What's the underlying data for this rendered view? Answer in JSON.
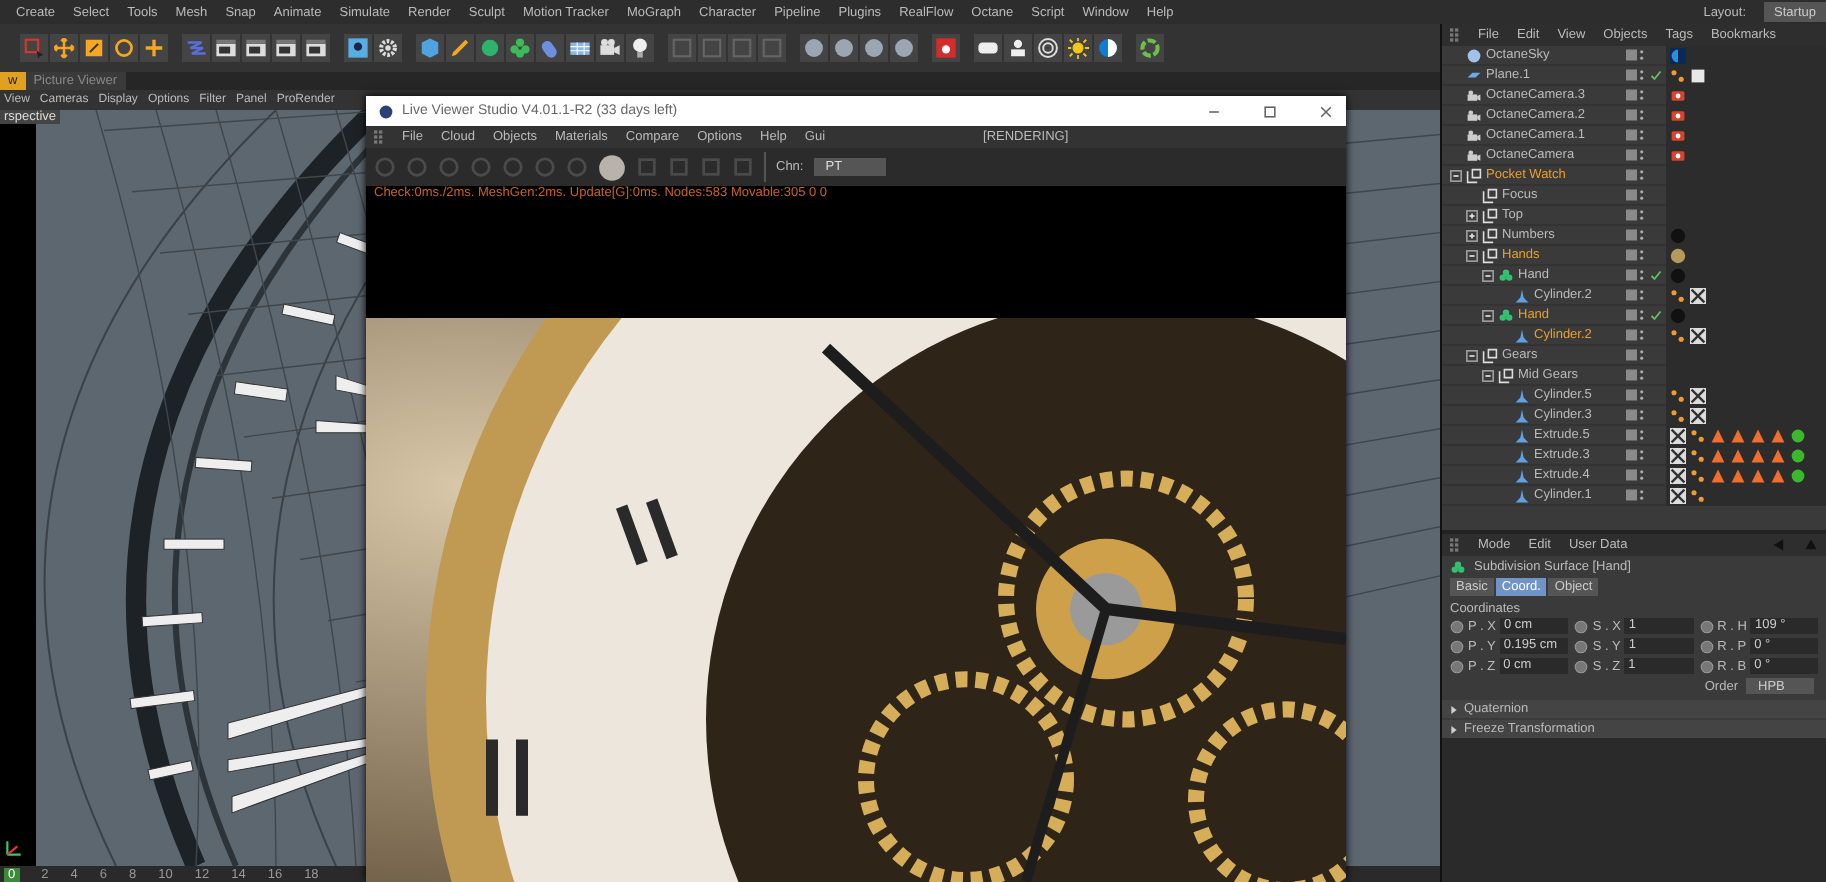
{
  "menu_bar": {
    "items": [
      "Create",
      "Select",
      "Tools",
      "Mesh",
      "Snap",
      "Animate",
      "Simulate",
      "Render",
      "Sculpt",
      "Motion Tracker",
      "MoGraph",
      "Character",
      "Pipeline",
      "Plugins",
      "RealFlow",
      "Octane",
      "Script",
      "Window",
      "Help"
    ],
    "layout_label": "Layout:",
    "layout_value": "Startup"
  },
  "view_tabs": [
    {
      "label": "w",
      "selected": true
    },
    {
      "label": "Picture Viewer",
      "selected": false
    }
  ],
  "viewport": {
    "menu": [
      "View",
      "Cameras",
      "Display",
      "Options",
      "Filter",
      "Panel",
      "ProRender"
    ],
    "camera_label": "rspective",
    "timeline_ticks": [
      "0",
      "2",
      "4",
      "6",
      "8",
      "10",
      "12",
      "14",
      "16",
      "18"
    ]
  },
  "live_viewer": {
    "title": "Live Viewer Studio V4.01.1-R2 (33 days left)",
    "menu": [
      "File",
      "Cloud",
      "Objects",
      "Materials",
      "Compare",
      "Options",
      "Help",
      "Gui"
    ],
    "status": "[RENDERING]",
    "channel_label": "Chn:",
    "channel_value": "PT",
    "stats": "Check:0ms./2ms. MeshGen:2ms. Update[G]:0ms. Nodes:583 Movable:305  0 0"
  },
  "object_manager": {
    "menu": [
      "File",
      "Edit",
      "View",
      "Objects",
      "Tags",
      "Bookmarks"
    ],
    "objects": [
      {
        "name": "OctaneSky",
        "kind": "sky",
        "selected": false,
        "checked": false,
        "tags": [
          {
            "kind": "sky"
          }
        ]
      },
      {
        "name": "Plane.1",
        "kind": "plane",
        "selected": false,
        "checked": true,
        "tags": [
          {
            "kind": "dots"
          },
          {
            "kind": "white"
          }
        ]
      },
      {
        "name": "OctaneCamera.3",
        "kind": "camera",
        "selected": false,
        "checked": false,
        "tags": [
          {
            "kind": "camera"
          }
        ]
      },
      {
        "name": "OctaneCamera.2",
        "kind": "camera",
        "selected": false,
        "checked": false,
        "tags": [
          {
            "kind": "camera"
          }
        ]
      },
      {
        "name": "OctaneCamera.1",
        "kind": "camera",
        "selected": false,
        "checked": false,
        "tags": [
          {
            "kind": "camera"
          }
        ]
      },
      {
        "name": "OctaneCamera",
        "kind": "camera",
        "selected": false,
        "checked": false,
        "tags": [
          {
            "kind": "camera"
          }
        ]
      },
      {
        "name": "Pocket Watch",
        "kind": "null",
        "selected": true,
        "checked": false,
        "expanded": true,
        "children": [
          {
            "name": "Focus",
            "kind": "null",
            "selected": false,
            "checked": false
          },
          {
            "name": "Top",
            "kind": "null",
            "selected": false,
            "checked": false,
            "expanded": false
          },
          {
            "name": "Numbers",
            "kind": "null",
            "selected": false,
            "checked": false,
            "expanded": false,
            "tags": [
              {
                "kind": "black"
              }
            ]
          },
          {
            "name": "Hands",
            "kind": "null",
            "selected": true,
            "checked": false,
            "expanded": true,
            "tags": [
              {
                "kind": "gold"
              }
            ],
            "children": [
              {
                "name": "Hand",
                "kind": "subdivision",
                "selected": false,
                "checked": true,
                "expanded": true,
                "tags": [
                  {
                    "kind": "black"
                  }
                ],
                "children": [
                  {
                    "name": "Cylinder.2",
                    "kind": "primitive",
                    "selected": false,
                    "checked": false,
                    "tags": [
                      {
                        "kind": "dots"
                      },
                      {
                        "kind": "checker"
                      }
                    ]
                  }
                ]
              },
              {
                "name": "Hand",
                "kind": "subdivision",
                "selected": true,
                "checked": true,
                "expanded": true,
                "tags": [
                  {
                    "kind": "black"
                  }
                ],
                "children": [
                  {
                    "name": "Cylinder.2",
                    "kind": "primitive",
                    "selected": true,
                    "checked": false,
                    "tags": [
                      {
                        "kind": "dots"
                      },
                      {
                        "kind": "checker"
                      }
                    ]
                  }
                ]
              }
            ]
          },
          {
            "name": "Gears",
            "kind": "null",
            "selected": false,
            "checked": false,
            "expanded": true,
            "children": [
              {
                "name": "Mid Gears",
                "kind": "null",
                "selected": false,
                "checked": false,
                "expanded": true,
                "children": [
                  {
                    "name": "Cylinder.5",
                    "kind": "primitive",
                    "selected": false,
                    "checked": false,
                    "tags": [
                      {
                        "kind": "dots"
                      },
                      {
                        "kind": "checker"
                      }
                    ]
                  },
                  {
                    "name": "Cylinder.3",
                    "kind": "primitive",
                    "selected": false,
                    "checked": false,
                    "tags": [
                      {
                        "kind": "dots"
                      },
                      {
                        "kind": "checker"
                      }
                    ]
                  },
                  {
                    "name": "Extrude.5",
                    "kind": "primitive",
                    "selected": false,
                    "checked": false,
                    "tags": [
                      {
                        "kind": "checker"
                      },
                      {
                        "kind": "dots"
                      },
                      {
                        "kind": "cone"
                      },
                      {
                        "kind": "cone"
                      },
                      {
                        "kind": "cone"
                      },
                      {
                        "kind": "cone"
                      },
                      {
                        "kind": "green"
                      }
                    ]
                  },
                  {
                    "name": "Extrude.3",
                    "kind": "primitive",
                    "selected": false,
                    "checked": false,
                    "tags": [
                      {
                        "kind": "checker"
                      },
                      {
                        "kind": "dots"
                      },
                      {
                        "kind": "cone"
                      },
                      {
                        "kind": "cone"
                      },
                      {
                        "kind": "cone"
                      },
                      {
                        "kind": "cone"
                      },
                      {
                        "kind": "green"
                      }
                    ]
                  },
                  {
                    "name": "Extrude.4",
                    "kind": "primitive",
                    "selected": false,
                    "checked": false,
                    "tags": [
                      {
                        "kind": "checker"
                      },
                      {
                        "kind": "dots"
                      },
                      {
                        "kind": "cone"
                      },
                      {
                        "kind": "cone"
                      },
                      {
                        "kind": "cone"
                      },
                      {
                        "kind": "cone"
                      },
                      {
                        "kind": "green"
                      }
                    ]
                  },
                  {
                    "name": "Cylinder.1",
                    "kind": "primitive",
                    "selected": false,
                    "checked": false,
                    "tags": [
                      {
                        "kind": "checker"
                      },
                      {
                        "kind": "dots"
                      }
                    ]
                  }
                ]
              }
            ]
          }
        ]
      }
    ]
  },
  "attribute_manager": {
    "menu": [
      "Mode",
      "Edit",
      "User Data"
    ],
    "title": "Subdivision Surface [Hand]",
    "tabs": [
      {
        "label": "Basic",
        "selected": false
      },
      {
        "label": "Coord.",
        "selected": true
      },
      {
        "label": "Object",
        "selected": false
      }
    ],
    "section": "Coordinates",
    "fields": [
      [
        {
          "label": "P . X",
          "value": "0 cm"
        },
        {
          "label": "S . X",
          "value": "1"
        },
        {
          "label": "R . H",
          "value": "109 °"
        }
      ],
      [
        {
          "label": "P . Y",
          "value": "0.195 cm"
        },
        {
          "label": "S . Y",
          "value": "1"
        },
        {
          "label": "R . P",
          "value": "0 °"
        }
      ],
      [
        {
          "label": "P . Z",
          "value": "0 cm"
        },
        {
          "label": "S . Z",
          "value": "1"
        },
        {
          "label": "R . B",
          "value": "0 °"
        }
      ]
    ],
    "order_label": "Order",
    "order_value": "HPB",
    "groups": [
      {
        "label": "Quaternion",
        "expanded": false
      },
      {
        "label": "Freeze Transformation",
        "expanded": false
      }
    ]
  }
}
